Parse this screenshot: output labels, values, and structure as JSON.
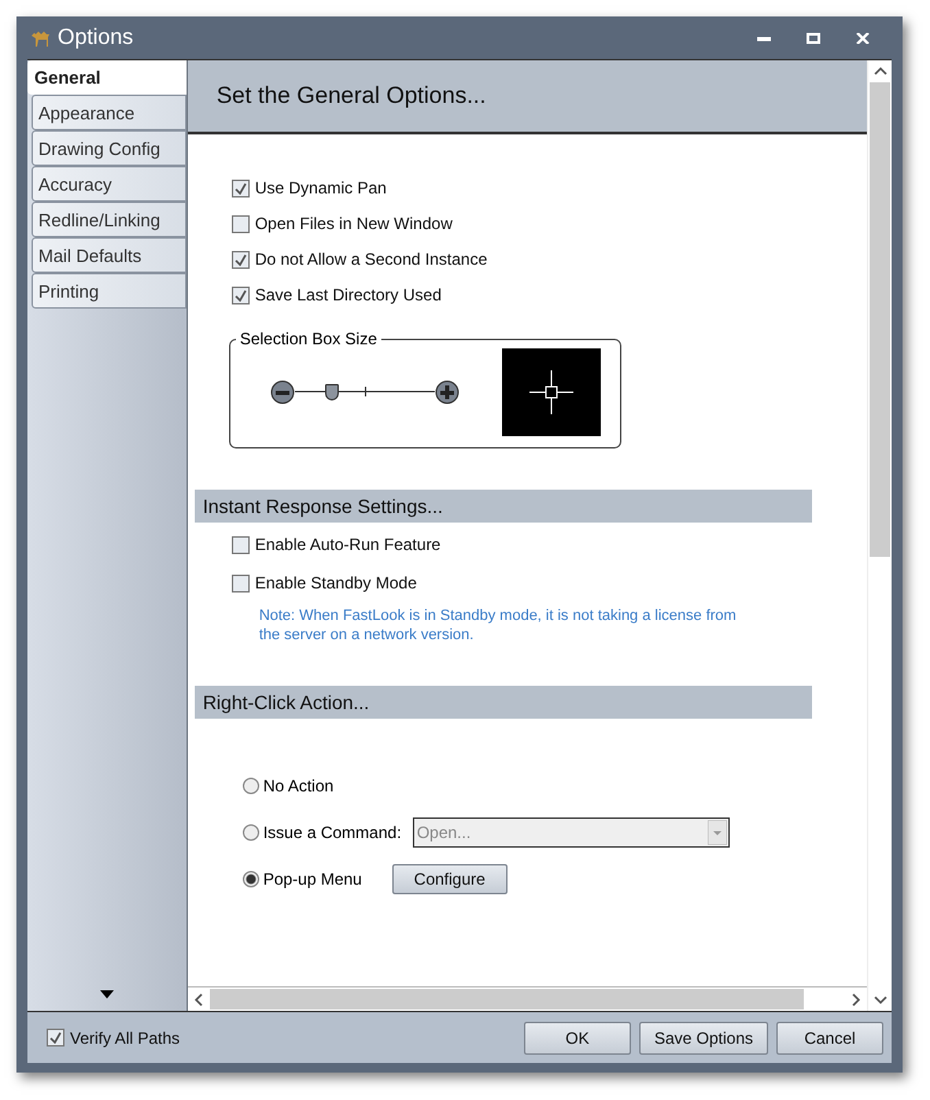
{
  "window": {
    "title": "Options"
  },
  "sidebar": {
    "items": [
      {
        "label": "General",
        "selected": true
      },
      {
        "label": "Appearance",
        "selected": false
      },
      {
        "label": "Drawing Config",
        "selected": false
      },
      {
        "label": "Accuracy",
        "selected": false
      },
      {
        "label": "Redline/Linking",
        "selected": false
      },
      {
        "label": "Mail Defaults",
        "selected": false
      },
      {
        "label": "Printing",
        "selected": false
      }
    ]
  },
  "header": "Set the General Options...",
  "general_options": [
    {
      "label": "Use Dynamic Pan",
      "checked": true
    },
    {
      "label": "Open Files in New Window",
      "checked": false
    },
    {
      "label": "Do not Allow a Second Instance",
      "checked": true
    },
    {
      "label": "Save Last Directory Used",
      "checked": true
    }
  ],
  "selection_box": {
    "title": "Selection Box Size",
    "level": 0.27
  },
  "instant_response": {
    "title": "Instant Response Settings...",
    "options": [
      {
        "label": "Enable Auto-Run Feature",
        "checked": false
      },
      {
        "label": "Enable Standby Mode",
        "checked": false
      }
    ],
    "note": "Note: When FastLook is in Standby mode, it is not taking a license from the server on a network version."
  },
  "right_click": {
    "title": "Right-Click Action...",
    "options": [
      {
        "label": "No Action",
        "selected": false
      },
      {
        "label": "Issue a Command:",
        "selected": false,
        "kind": "dropdown",
        "value": "Open..."
      },
      {
        "label": "Pop-up Menu",
        "selected": true,
        "kind": "button",
        "button": "Configure"
      }
    ]
  },
  "footer": {
    "verify": {
      "label": "Verify All Paths",
      "checked": true
    },
    "buttons": [
      "OK",
      "Save Options",
      "Cancel"
    ]
  }
}
